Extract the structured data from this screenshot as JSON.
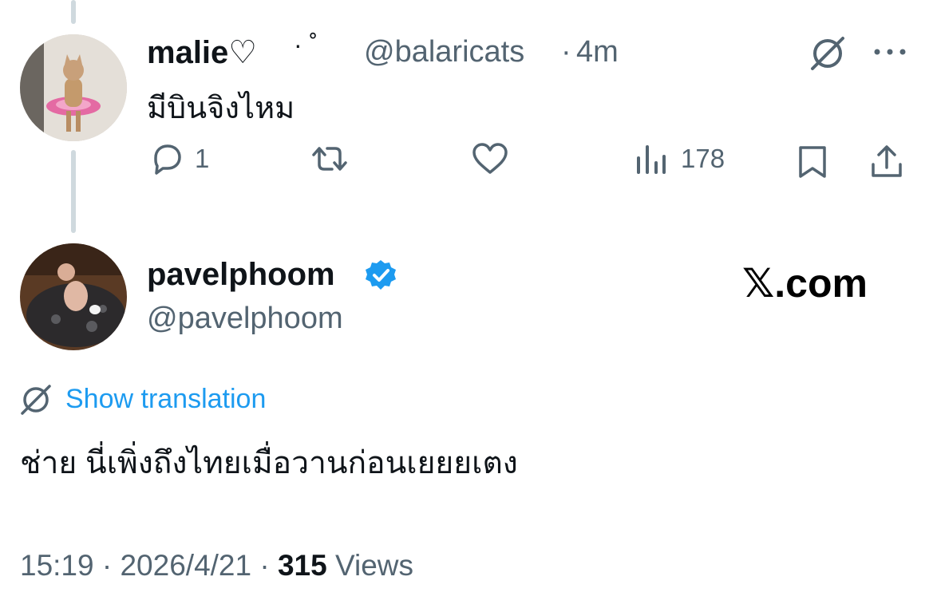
{
  "reply": {
    "display_name": "malie♡",
    "name_suffix": "· ˚",
    "handle": "@balaricats",
    "time": "4m",
    "text": "มีบินจิงไหม",
    "actions": {
      "reply_count": "1",
      "retweet_count": "",
      "like_count": "",
      "views_count": "178"
    },
    "icons": [
      "translate-icon",
      "more-icon",
      "reply-icon",
      "retweet-icon",
      "like-icon",
      "views-icon",
      "bookmark-icon",
      "share-icon"
    ]
  },
  "main_post": {
    "display_name": "pavelphoom",
    "verified": true,
    "handle": "@pavelphoom",
    "site_label": "𝕏.com",
    "show_translation": "Show translation",
    "text": "ช่าย นี่เพิ่งถึงไทยเมื่อวานก่อนเยยยเตง",
    "time": "15:19",
    "date": "2026/4/21",
    "views_count": "315",
    "views_label": "Views"
  },
  "colors": {
    "accent": "#1d9bf0",
    "secondary_text": "#536471",
    "thread_line": "#cfd9de"
  }
}
